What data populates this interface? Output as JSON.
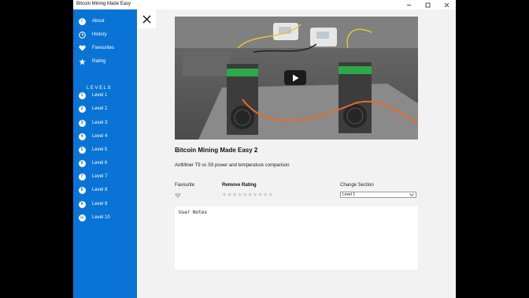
{
  "window": {
    "title": "Bitcoin Mining Made Easy",
    "controls": {
      "minimize": "—",
      "maximize": "☐",
      "close": "✕"
    }
  },
  "sidebar": {
    "items": [
      {
        "label": "About",
        "icon": "info-icon",
        "glyph": "i"
      },
      {
        "label": "History",
        "icon": "clock-icon"
      },
      {
        "label": "Favourites",
        "icon": "heart-icon"
      },
      {
        "label": "Rating",
        "icon": "star-icon"
      }
    ],
    "levels_heading": "LEVELS",
    "levels": [
      {
        "label": "Level 1",
        "num": "1"
      },
      {
        "label": "Level 2",
        "num": "2"
      },
      {
        "label": "Level 3",
        "num": "3"
      },
      {
        "label": "Level 4",
        "num": "4"
      },
      {
        "label": "Level 5",
        "num": "5"
      },
      {
        "label": "Level 6",
        "num": "6"
      },
      {
        "label": "Level 7",
        "num": "7"
      },
      {
        "label": "Level 8",
        "num": "8"
      },
      {
        "label": "Level 9",
        "num": "9"
      },
      {
        "label": "Level 10",
        "num": "10"
      }
    ]
  },
  "main": {
    "close_glyph": "✕",
    "video": {
      "title": "Bitcoin Mining Made Easy 2",
      "description": "AntMiner T9 vs S9 power and temperature comparison"
    },
    "favourite_label": "Favourite",
    "remove_rating_label": "Remove Rating",
    "rating": {
      "max": 10,
      "value": 0
    },
    "change_section_label": "Change Section",
    "section_selected": "Level 1",
    "notes_placeholder": "User Notes"
  },
  "colors": {
    "accent": "#0a74d6",
    "background": "#f2f2f2",
    "star_empty": "#c8c8c8"
  }
}
